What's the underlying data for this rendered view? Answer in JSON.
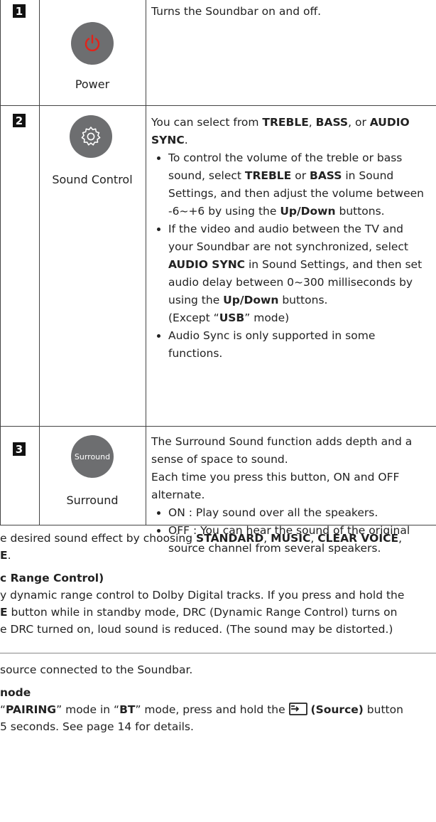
{
  "rows": [
    {
      "number": "1",
      "button_label": "Power",
      "description": "Turns the Soundbar on and off."
    },
    {
      "number": "2",
      "button_label": "Sound Control",
      "intro_a": "You can select from ",
      "treble": "TREBLE",
      "sep1": ", ",
      "bass": "BASS",
      "sep2": ", or ",
      "audio_sync": "AUDIO SYNC",
      "end": ".",
      "bullet1_a": "To control the volume of the treble or bass sound, select ",
      "bullet1_treble": "TREBLE",
      "bullet1_or": " or ",
      "bullet1_bass": "BASS",
      "bullet1_b": " in Sound Settings, and then adjust the volume between -6~+6 by using the ",
      "bullet1_updown": "Up/Down",
      "bullet1_c": " buttons.",
      "bullet2_a": "If the video and audio between the TV and your Soundbar are not synchronized, select ",
      "bullet2_audio_sync": "AUDIO SYNC",
      "bullet2_b": " in Sound Settings, and then set audio delay between 0~300 milliseconds by using the ",
      "bullet2_updown": "Up/Down",
      "bullet2_c": " buttons.",
      "bullet2_d": "(Except “",
      "bullet2_usb": "USB",
      "bullet2_e": "” mode)",
      "bullet3": "Audio Sync is only supported in some functions."
    },
    {
      "number": "3",
      "button_text": "Surround",
      "button_label": "Surround",
      "para1": "The Surround Sound function adds depth and a sense of space to sound.",
      "para2": "Each time you press this button, ON and OFF alternate.",
      "bullet1": "ON : Play sound over all the speakers.",
      "bullet2": "OFF : You can hear the sound of the original source channel from several speakers."
    }
  ],
  "below": {
    "line1_a": "e desired sound effect by choosing ",
    "standard": "STANDARD",
    "c1": ", ",
    "music": "MUSIC",
    "c2": ", ",
    "clear_voice": "CLEAR VOICE",
    "c3": ",",
    "line2_bold": "E",
    "line2_end": ".",
    "heading_drc": "c Range Control)",
    "drc1": "y dynamic range control to Dolby Digital tracks. If you press and hold the",
    "drc2_bold": "E",
    "drc2": " button while in standby mode, DRC (Dynamic Range Control) turns on",
    "drc3": "e DRC turned on, loud sound is reduced. (The sound may be distorted.)",
    "source1": "source connected to the Soundbar.",
    "heading_mode": "node",
    "pair_a": "“",
    "pairing": "PAIRING",
    "pair_b": "” mode in “",
    "bt": "BT",
    "pair_c": "” mode, press and hold the ",
    "source_label": "(Source)",
    "pair_d": " button",
    "pair2": " 5 seconds. See page 14 for details."
  },
  "icons": [
    "power-icon",
    "gear-icon",
    "source-icon"
  ],
  "colors": {
    "button_grey": "#6d6e70",
    "power_red": "#e2231a"
  }
}
